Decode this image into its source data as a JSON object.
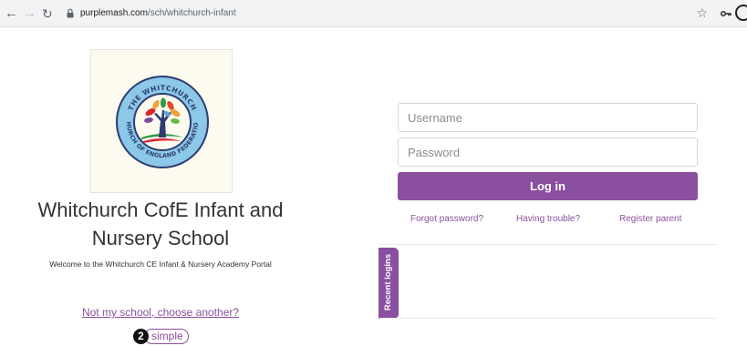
{
  "browser": {
    "url_host": "purplemash.com",
    "url_path": "/sch/whitchurch-infant"
  },
  "school": {
    "logo_text_top": "THE WHITCHURCH",
    "logo_text_bottom": "CHURCH OF ENGLAND FEDERATION",
    "name": "Whitchurch CofE Infant and Nursery School",
    "welcome": "Welcome to the Whitchurch CE Infant & Nursery Academy Portal",
    "not_my_school": "Not my school, choose another?"
  },
  "brand": {
    "number": "2",
    "word": "simple"
  },
  "login": {
    "username_placeholder": "Username",
    "password_placeholder": "Password",
    "login_label": "Log in",
    "forgot_password": "Forgot password?",
    "having_trouble": "Having trouble?",
    "register_parent": "Register parent",
    "recent_logins": "Recent logins"
  },
  "colors": {
    "accent": "#8a4f9e",
    "logo_ring": "#8cc8e8",
    "logo_border": "#2e3c6e"
  }
}
